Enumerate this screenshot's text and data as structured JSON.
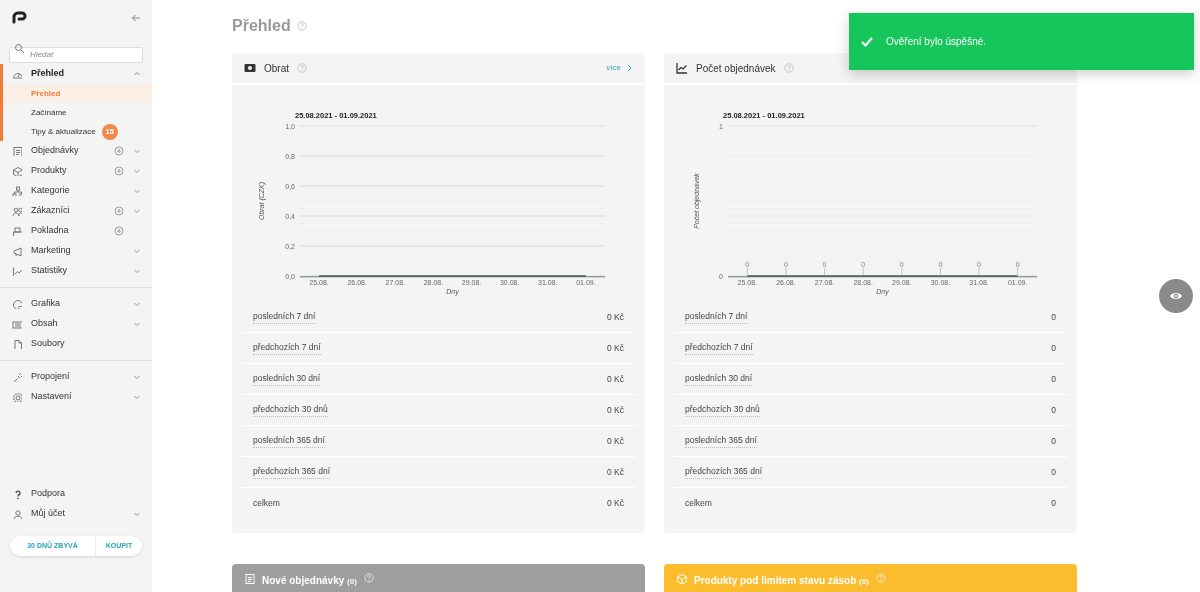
{
  "sidebar": {
    "search_placeholder": "Hledat",
    "groups": [
      [
        {
          "label": "Přehled",
          "selected": true,
          "expanded": true,
          "children": [
            {
              "label": "Přehled",
              "selected": true
            },
            {
              "label": "Začínáme",
              "selected": false
            },
            {
              "label": "Tipy & aktualizace",
              "selected": false,
              "badge": "15"
            }
          ]
        },
        {
          "label": "Objednávky",
          "selected": false,
          "add": true,
          "expanded": false
        },
        {
          "label": "Produkty",
          "selected": false,
          "add": true,
          "expanded": false
        },
        {
          "label": "Kategorie",
          "selected": false,
          "expanded": false
        },
        {
          "label": "Zákazníci",
          "selected": false,
          "add": true,
          "expanded": false
        },
        {
          "label": "Pokladna",
          "selected": false,
          "add": true
        },
        {
          "label": "Marketing",
          "selected": false,
          "expanded": false
        },
        {
          "label": "Statistiky",
          "selected": false,
          "expanded": false
        }
      ],
      [
        {
          "label": "Grafika",
          "selected": false,
          "expanded": false
        },
        {
          "label": "Obsah",
          "selected": false,
          "expanded": false
        },
        {
          "label": "Soubory",
          "selected": false
        }
      ],
      [
        {
          "label": "Propojení",
          "selected": false,
          "expanded": false
        },
        {
          "label": "Nastavení",
          "selected": false,
          "expanded": false
        }
      ]
    ],
    "footer": [
      {
        "label": "Podpora",
        "selected": false
      },
      {
        "label": "Můj účet",
        "selected": false,
        "expanded": false
      }
    ],
    "trial": {
      "remaining": "30 DNŮ ZBÝVÁ",
      "buy": "KOUPIT"
    }
  },
  "page": {
    "title": "Přehled"
  },
  "cards": [
    {
      "title": "Obrat",
      "link": "více",
      "chart_data": {
        "type": "line",
        "title": "25.08.2021 - 01.09.2021",
        "xlabel": "Dny",
        "ylabel": "Obrat (CZK)",
        "categories": [
          "25.08.",
          "26.08.",
          "27.08.",
          "28.08.",
          "29.08.",
          "30.08.",
          "31.08.",
          "01.09."
        ],
        "ylim": [
          0,
          1
        ],
        "grid": true,
        "yticks": [
          {
            "value": 0,
            "label": "0,0"
          },
          {
            "value": 0.2,
            "label": "0,2"
          },
          {
            "value": 0.4,
            "label": "0,4"
          },
          {
            "value": 0.6,
            "label": "0,6"
          },
          {
            "value": 0.8,
            "label": "0,8"
          },
          {
            "value": 1,
            "label": "1,0"
          }
        ],
        "series": [
          {
            "color": "#3f5a55",
            "values": [
              0,
              0,
              0,
              0,
              0,
              0,
              0,
              0
            ]
          }
        ]
      },
      "stats": [
        {
          "label": "posledních 7 dní",
          "value": "0 Kč"
        },
        {
          "label": "předchozích 7 dní",
          "value": "0 Kč"
        },
        {
          "label": "posledních 30 dní",
          "value": "0 Kč"
        },
        {
          "label": "předchozích 30 dnů",
          "value": "0 Kč"
        },
        {
          "label": "posledních 365 dní",
          "value": "0 Kč"
        },
        {
          "label": "předchozích 365 dní",
          "value": "0 Kč"
        },
        {
          "label": "celkem",
          "value": "0 Kč"
        }
      ]
    },
    {
      "title": "Počet objednávek",
      "chart_data": {
        "type": "line",
        "title": "25.08.2021 - 01.09.2021",
        "xlabel": "Dny",
        "ylabel": "Počet objednávek",
        "categories": [
          "25.08.",
          "26.08.",
          "27.08.",
          "28.08.",
          "29.08.",
          "30.08.",
          "31.08.",
          "01.09."
        ],
        "ylim": [
          0,
          1
        ],
        "grid": true,
        "yticks": [
          0,
          1
        ],
        "data_labels": true,
        "series": [
          {
            "color": "#3f5a55",
            "values": [
              0,
              0,
              0,
              0,
              0,
              0,
              0,
              0
            ]
          }
        ]
      },
      "stats": [
        {
          "label": "posledních 7 dní",
          "value": "0"
        },
        {
          "label": "předchozích 7 dní",
          "value": "0"
        },
        {
          "label": "posledních 30 dní",
          "value": "0"
        },
        {
          "label": "předchozích 30 dnů",
          "value": "0"
        },
        {
          "label": "posledních 365 dní",
          "value": "0"
        },
        {
          "label": "předchozích 365 dní",
          "value": "0"
        },
        {
          "label": "celkem",
          "value": "0"
        }
      ]
    }
  ],
  "panels": [
    {
      "title": "Nové objednávky",
      "count": "(0)",
      "color": "#9e9e9e"
    },
    {
      "title": "Produkty pod limitem stavu zásob",
      "count": "(0)",
      "color": "#fbbd2e"
    }
  ],
  "toast": {
    "message": "Ověření bylo úspěšné."
  }
}
